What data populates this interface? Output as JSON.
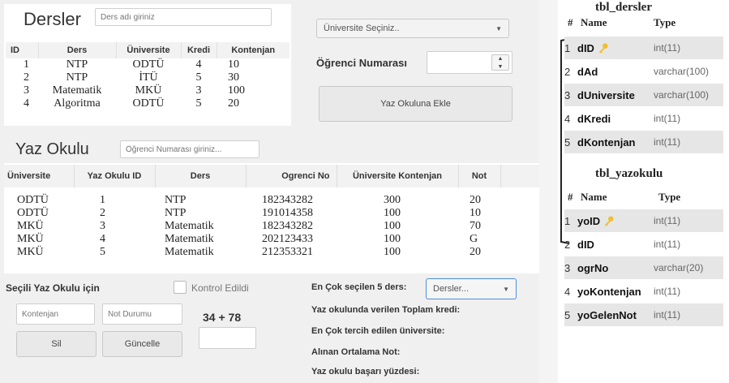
{
  "dersler": {
    "title": "Dersler",
    "search_placeholder": "Ders adı giriniz",
    "columns": [
      "ID",
      "Ders",
      "Üniversite",
      "Kredi",
      "Kontenjan"
    ],
    "rows": [
      [
        "1",
        "NTP",
        "ODTÜ",
        "4",
        "10"
      ],
      [
        "2",
        "NTP",
        "İTÜ",
        "5",
        "30"
      ],
      [
        "3",
        "Matematik",
        "MKÜ",
        "3",
        "100"
      ],
      [
        "4",
        "Algoritma",
        "ODTÜ",
        "5",
        "20"
      ]
    ]
  },
  "right_controls": {
    "university_combo": "Üniversite Seçiniz..",
    "student_no_label": "Öğrenci Numarası",
    "add_button": "Yaz Okuluna Ekle"
  },
  "yaz_okulu": {
    "title": "Yaz Okulu",
    "search_placeholder": "Öğrenci Numarası giriniz...",
    "columns": [
      "Üniversite",
      "Yaz Okulu ID",
      "Ders",
      "Ogrenci No",
      "Üniversite Kontenjan",
      "Not"
    ],
    "rows": [
      [
        "ODTÜ",
        "1",
        "NTP",
        "182343282",
        "300",
        "20"
      ],
      [
        "ODTÜ",
        "2",
        "NTP",
        "191014358",
        "100",
        "10"
      ],
      [
        "MKÜ",
        "3",
        "Matematik",
        "182343282",
        "100",
        "70"
      ],
      [
        "MKÜ",
        "4",
        "Matematik",
        "202123433",
        "100",
        "G"
      ],
      [
        "MKÜ",
        "5",
        "Matematik",
        "212353321",
        "100",
        "20"
      ]
    ]
  },
  "bottom": {
    "selected_label": "Seçili Yaz Okulu için",
    "checkbox_label": "Kontrol Edildi",
    "kontenjan_placeholder": "Kontenjan",
    "not_placeholder": "Not Durumu",
    "sum_text": "34 + 78",
    "delete_button": "Sil",
    "update_button": "Güncelle",
    "top5_label": "En Çok seçilen 5 ders:",
    "top5_combo": "Dersler...",
    "total_credit_label": "Yaz okulunda verilen Toplam kredi:",
    "most_uni_label": "En Çok tercih edilen üniversite:",
    "avg_label": "Alınan Ortalama Not:",
    "success_label": "Yaz okulu başarı yüzdesi:"
  },
  "schema": {
    "tbl_dersler": {
      "title": "tbl_dersler",
      "header_hash": "#",
      "header_name": "Name",
      "header_type": "Type",
      "rows": [
        {
          "num": "1",
          "name": "dID",
          "type": "int(11)",
          "key": true
        },
        {
          "num": "2",
          "name": "dAd",
          "type": "varchar(100)",
          "key": false
        },
        {
          "num": "3",
          "name": "dUniversite",
          "type": "varchar(100)",
          "key": false
        },
        {
          "num": "4",
          "name": "dKredi",
          "type": "int(11)",
          "key": false
        },
        {
          "num": "5",
          "name": "dKontenjan",
          "type": "int(11)",
          "key": false
        }
      ]
    },
    "tbl_yazokulu": {
      "title": "tbl_yazokulu",
      "header_hash": "#",
      "header_name": "Name",
      "header_type": "Type",
      "rows": [
        {
          "num": "1",
          "name": "yoID",
          "type": "int(11)",
          "key": true
        },
        {
          "num": "2",
          "name": "dID",
          "type": "int(11)",
          "key": false
        },
        {
          "num": "3",
          "name": "ogrNo",
          "type": "varchar(20)",
          "key": false
        },
        {
          "num": "4",
          "name": "yoKontenjan",
          "type": "int(11)",
          "key": false
        },
        {
          "num": "5",
          "name": "yoGelenNot",
          "type": "int(11)",
          "key": false
        }
      ]
    }
  },
  "colors": {
    "key_icon": "#f0c030",
    "combo_focus": "#4a90d9"
  }
}
